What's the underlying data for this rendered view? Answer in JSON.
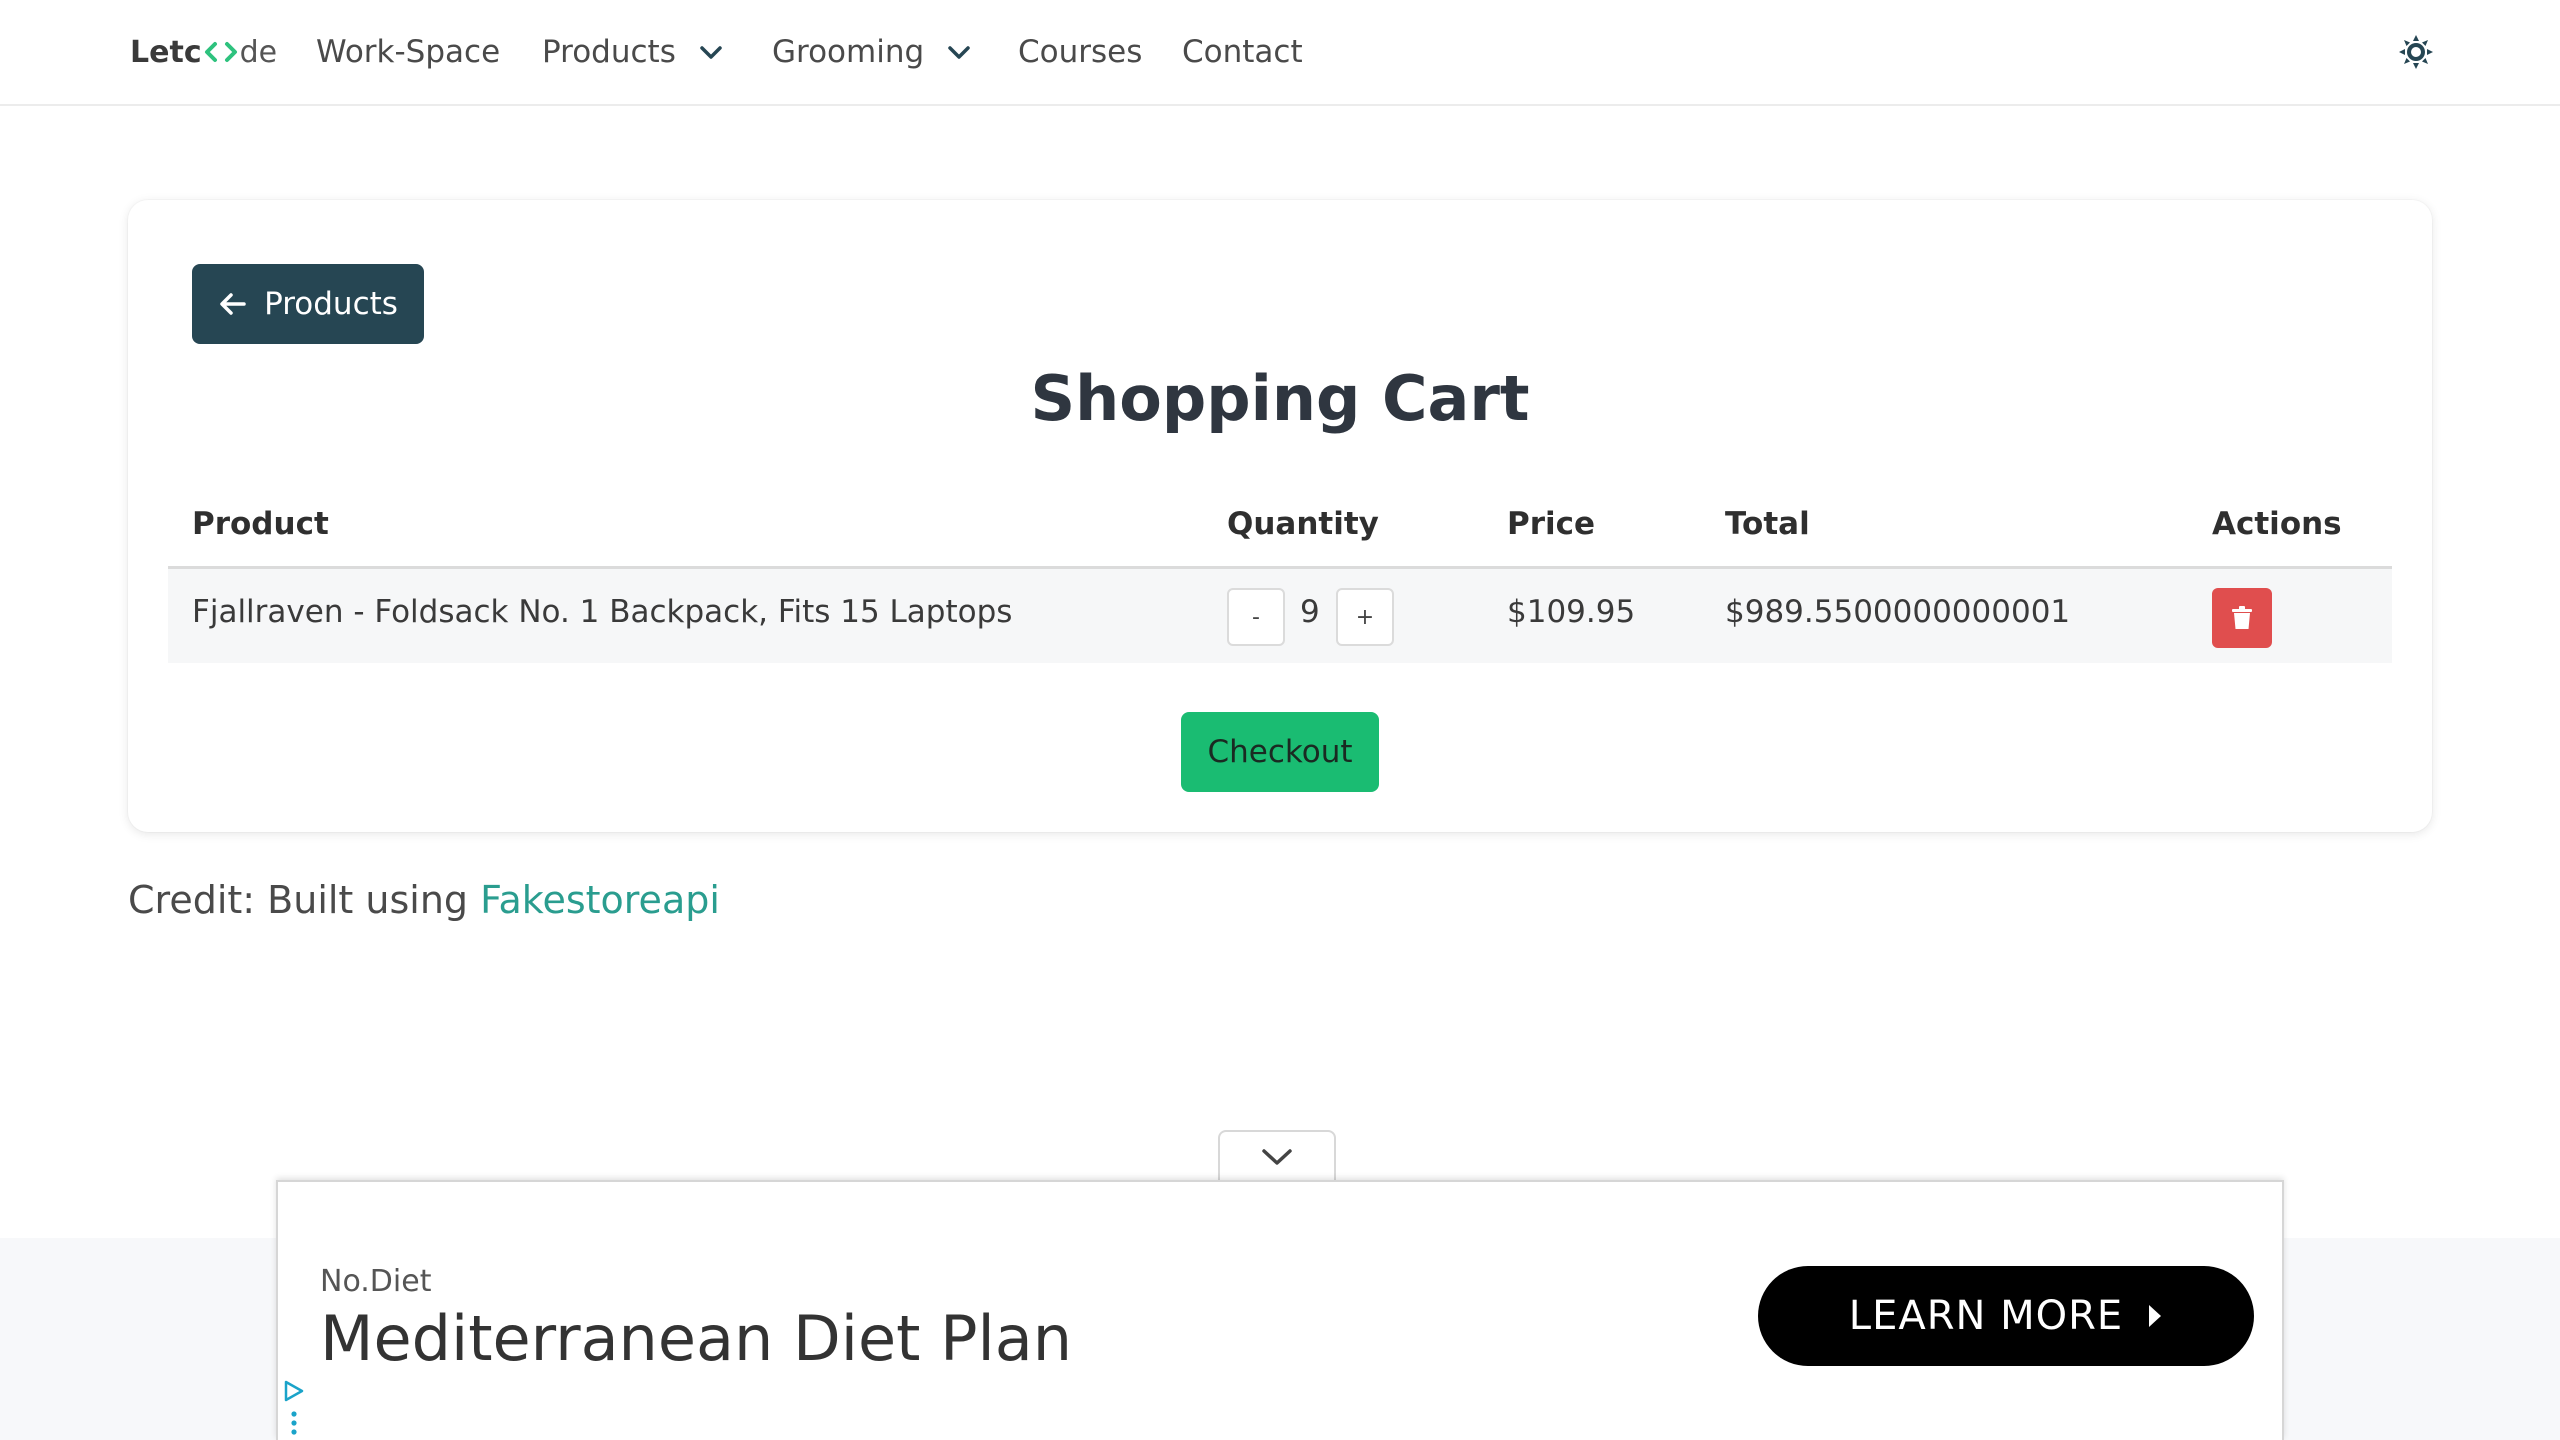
{
  "nav": {
    "brand_prefix": "Let",
    "brand_suffix": "de",
    "items": [
      {
        "label": "Work-Space"
      },
      {
        "label": "Products"
      },
      {
        "label": "Grooming"
      },
      {
        "label": "Courses"
      },
      {
        "label": "Contact"
      }
    ]
  },
  "cart": {
    "back_label": "Products",
    "title": "Shopping Cart",
    "columns": [
      "Product",
      "Quantity",
      "Price",
      "Total",
      "Actions"
    ],
    "rows": [
      {
        "product": "Fjallraven - Foldsack No. 1 Backpack, Fits 15 Laptops",
        "quantity": "9",
        "decrement": "-",
        "increment": "+",
        "price": "$109.95",
        "total": "$989.5500000000001"
      }
    ],
    "checkout_label": "Checkout"
  },
  "credit": {
    "prefix": "Credit: Built using ",
    "link": "Fakestoreapi"
  },
  "ad": {
    "advertiser": "No.Diet",
    "headline": "Mediterranean Diet Plan",
    "cta": "LEARN MORE"
  },
  "colors": {
    "brand_dark": "#264653",
    "checkout_green": "#1abc72",
    "delete_red": "#e04e4e",
    "link_teal": "#2a9d8f"
  }
}
